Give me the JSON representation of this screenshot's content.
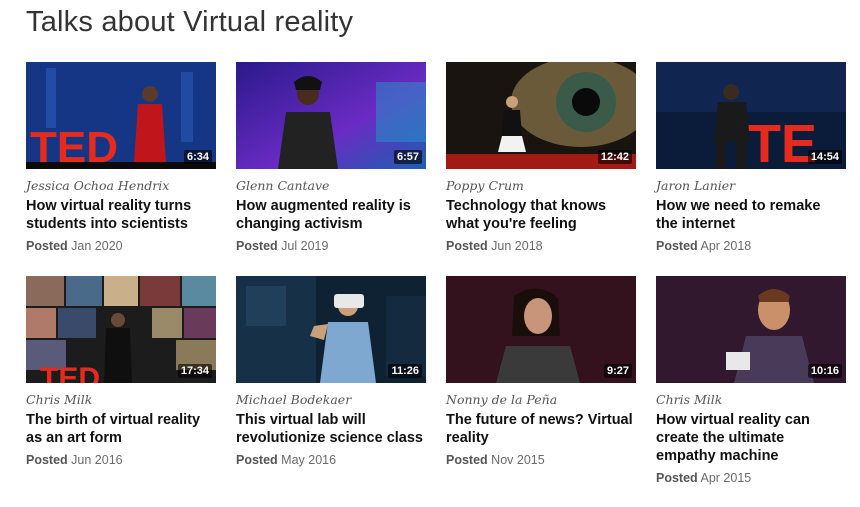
{
  "section": {
    "title": "Talks about Virtual reality"
  },
  "talks": [
    {
      "speaker": "Jessica Ochoa Hendrix",
      "title": "How virtual reality turns students into scientists",
      "posted_label": "Posted",
      "posted_date": "Jan 2020",
      "duration": "6:34",
      "thumbnail": "speaker-on-ted-stage-red-dress"
    },
    {
      "speaker": "Glenn Cantave",
      "title": "How augmented reality is changing activism",
      "posted_label": "Posted",
      "posted_date": "Jul 2019",
      "duration": "6:57",
      "thumbnail": "speaker-purple-background"
    },
    {
      "speaker": "Poppy Crum",
      "title": "Technology that knows what you're feeling",
      "posted_label": "Posted",
      "posted_date": "Jun 2018",
      "duration": "12:42",
      "thumbnail": "speaker-giant-eye-screen"
    },
    {
      "speaker": "Jaron Lanier",
      "title": "How we need to remake the internet",
      "posted_label": "Posted",
      "posted_date": "Apr 2018",
      "duration": "14:54",
      "thumbnail": "speaker-ted-letters"
    },
    {
      "speaker": "Chris Milk",
      "title": "The birth of virtual reality as an art form",
      "posted_label": "Posted",
      "posted_date": "Jun 2016",
      "duration": "17:34",
      "thumbnail": "speaker-photo-collage"
    },
    {
      "speaker": "Michael Bodekaer",
      "title": "This virtual lab will revolutionize science class",
      "posted_label": "Posted",
      "posted_date": "May 2016",
      "duration": "11:26",
      "thumbnail": "speaker-vr-headset"
    },
    {
      "speaker": "Nonny de la Peña",
      "title": "The future of news? Virtual reality",
      "posted_label": "Posted",
      "posted_date": "Nov 2015",
      "duration": "9:27",
      "thumbnail": "speaker-dark-background"
    },
    {
      "speaker": "Chris Milk",
      "title": "How virtual reality can create the ultimate empathy machine",
      "posted_label": "Posted",
      "posted_date": "Apr 2015",
      "duration": "10:16",
      "thumbnail": "speaker-closeup-dark"
    }
  ],
  "colors": {
    "ted_red": "#e62b1e",
    "text_primary": "#111111",
    "text_secondary": "#6b6b6b"
  }
}
